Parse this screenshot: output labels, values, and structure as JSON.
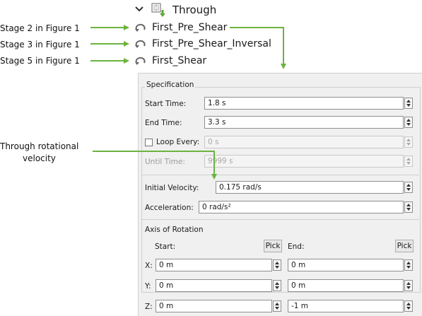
{
  "tree": {
    "root_label": "Through",
    "items": [
      {
        "label": "First_Pre_Shear"
      },
      {
        "label": "First_Pre_Shear_Inversal"
      },
      {
        "label": "First_Shear"
      }
    ]
  },
  "annotations": {
    "stage2": "Stage 2 in Figure 1",
    "stage3": "Stage 3 in Figure 1",
    "stage5": "Stage 5 in Figure 1",
    "rot_line1": "Through rotational",
    "rot_line2": "velocity"
  },
  "specification": {
    "title": "Specification",
    "start_time_label": "Start Time:",
    "start_time_value": "1.8 s",
    "end_time_label": "End Time:",
    "end_time_value": "3.3 s",
    "loop_every_label": "Loop Every:",
    "loop_every_value": "0 s",
    "loop_every_checked": false,
    "until_time_label": "Until Time:",
    "until_time_value": "9999 s",
    "initial_velocity_label": "Initial Velocity:",
    "initial_velocity_value": "0.175 rad/s",
    "acceleration_label": "Acceleration:",
    "acceleration_value": "0 rad/s²"
  },
  "axis": {
    "title": "Axis of Rotation",
    "start_label": "Start:",
    "end_label": "End:",
    "pick_label": "Pick",
    "x_label": "X:",
    "y_label": "Y:",
    "z_label": "Z:",
    "start_x": "0 m",
    "start_y": "0 m",
    "start_z": "0 m",
    "end_x": "0 m",
    "end_y": "0 m",
    "end_z": "-1 m"
  },
  "colors": {
    "arrow": "#6cb33f",
    "icon_green": "#5aa832"
  }
}
